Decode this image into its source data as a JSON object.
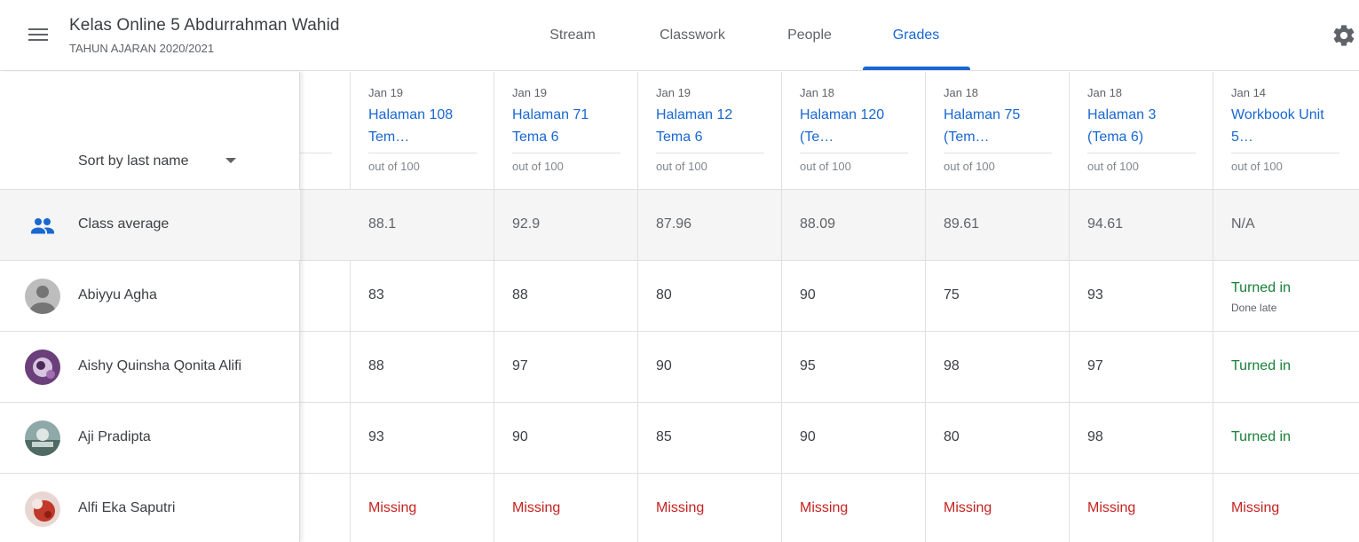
{
  "header": {
    "class_name": "Kelas Online 5 Abdurrahman Wahid",
    "school_year": "TAHUN AJARAN 2020/2021",
    "tabs": [
      {
        "label": "Stream"
      },
      {
        "label": "Classwork"
      },
      {
        "label": "People"
      },
      {
        "label": "Grades"
      }
    ],
    "active_tab": "Grades"
  },
  "sort": {
    "label": "Sort by last name"
  },
  "assignments": [
    {
      "date": "Jan 19",
      "title": "Halaman 108 Tem…",
      "points": "out of 100"
    },
    {
      "date": "Jan 19",
      "title": "Halaman 71 Tema 6",
      "points": "out of 100"
    },
    {
      "date": "Jan 19",
      "title": "Halaman 12 Tema 6",
      "points": "out of 100"
    },
    {
      "date": "Jan 18",
      "title": "Halaman 120 (Te…",
      "points": "out of 100"
    },
    {
      "date": "Jan 18",
      "title": "Halaman 75 (Tem…",
      "points": "out of 100"
    },
    {
      "date": "Jan 18",
      "title": "Halaman 3 (Tema 6)",
      "points": "out of 100"
    },
    {
      "date": "Jan 14",
      "title": "Workbook Unit 5…",
      "points": "out of 100"
    }
  ],
  "class_average": {
    "label": "Class average",
    "values": [
      "88.1",
      "92.9",
      "87.96",
      "88.09",
      "89.61",
      "94.61",
      "N/A"
    ]
  },
  "students": [
    {
      "name": "Abiyyu Agha",
      "grades": [
        "83",
        "88",
        "80",
        "90",
        "75",
        "93"
      ],
      "last": {
        "status": "Turned in",
        "note": "Done late"
      }
    },
    {
      "name": "Aishy Quinsha Qonita Alifi",
      "grades": [
        "88",
        "97",
        "90",
        "95",
        "98",
        "97"
      ],
      "last": {
        "status": "Turned in",
        "note": ""
      }
    },
    {
      "name": "Aji Pradipta",
      "grades": [
        "93",
        "90",
        "85",
        "90",
        "80",
        "98"
      ],
      "last": {
        "status": "Turned in",
        "note": ""
      }
    },
    {
      "name": "Alfi Eka Saputri",
      "grades": [
        "Missing",
        "Missing",
        "Missing",
        "Missing",
        "Missing",
        "Missing"
      ],
      "last": {
        "status": "Missing",
        "note": ""
      }
    }
  ],
  "colors": {
    "accent": "#1967d2",
    "missing": "#c5221f",
    "turned_in": "#188038"
  },
  "icons": {
    "menu": "hamburger-menu-icon",
    "settings": "gear-icon",
    "class_average": "people-icon",
    "default_avatar": "person-icon"
  }
}
